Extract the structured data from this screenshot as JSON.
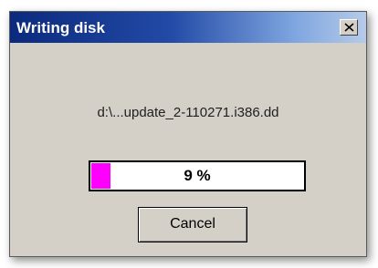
{
  "window": {
    "title": "Writing disk",
    "close_icon": "close-icon"
  },
  "file": {
    "name": "d:\\...update_2-110271.i386.dd"
  },
  "progress": {
    "percent": 9,
    "label": "9 %",
    "fill_color": "#ff00ff"
  },
  "buttons": {
    "cancel_label": "Cancel"
  }
}
